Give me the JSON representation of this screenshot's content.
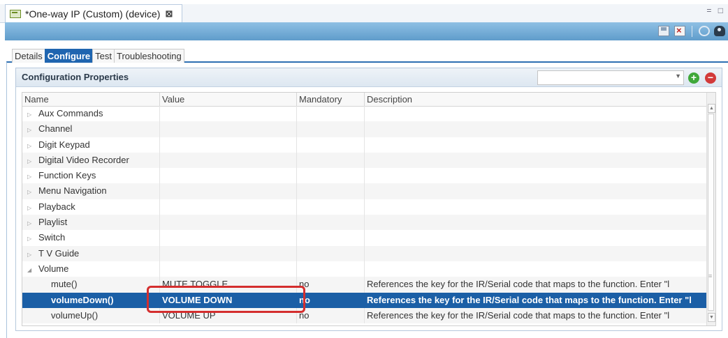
{
  "editor_tab": {
    "title": "*One-way IP (Custom) (device)",
    "close_icon": "close-icon"
  },
  "toolbar": {
    "icons": [
      "save-icon",
      "delete-icon",
      "refresh-icon",
      "preview-icon"
    ]
  },
  "window_controls": "= □",
  "subtabs": [
    "Details",
    "Configure",
    "Test",
    "Troubleshooting"
  ],
  "active_subtab": "Configure",
  "panel": {
    "title": "Configuration Properties",
    "combo_value": "",
    "add_label": "+",
    "remove_label": "−"
  },
  "table": {
    "columns": [
      "Name",
      "Value",
      "Mandatory",
      "Description"
    ],
    "rows": [
      {
        "name": "Aux Commands",
        "value": "",
        "mandatory": "",
        "description": "",
        "expander": "▷"
      },
      {
        "name": "Channel",
        "value": "",
        "mandatory": "",
        "description": "",
        "expander": "▷"
      },
      {
        "name": "Digit Keypad",
        "value": "",
        "mandatory": "",
        "description": "",
        "expander": "▷"
      },
      {
        "name": "Digital Video Recorder",
        "value": "",
        "mandatory": "",
        "description": "",
        "expander": "▷"
      },
      {
        "name": "Function Keys",
        "value": "",
        "mandatory": "",
        "description": "",
        "expander": "▷"
      },
      {
        "name": "Menu Navigation",
        "value": "",
        "mandatory": "",
        "description": "",
        "expander": "▷"
      },
      {
        "name": "Playback",
        "value": "",
        "mandatory": "",
        "description": "",
        "expander": "▷"
      },
      {
        "name": "Playlist",
        "value": "",
        "mandatory": "",
        "description": "",
        "expander": "▷"
      },
      {
        "name": "Switch",
        "value": "",
        "mandatory": "",
        "description": "",
        "expander": "▷"
      },
      {
        "name": "T V Guide",
        "value": "",
        "mandatory": "",
        "description": "",
        "expander": "▷"
      },
      {
        "name": "Volume",
        "value": "",
        "mandatory": "",
        "description": "",
        "expander": "◢"
      },
      {
        "name": "mute()",
        "value": "MUTE TOGGLE",
        "mandatory": "no",
        "description": "References the key for the IR/Serial code that maps to the function. Enter \"l",
        "expander": ""
      },
      {
        "name": "volumeDown()",
        "value": "VOLUME DOWN",
        "mandatory": "no",
        "description": "References the key for the IR/Serial code that maps to the function. Enter \"l",
        "expander": ""
      },
      {
        "name": "volumeUp()",
        "value": "VOLUME UP",
        "mandatory": "no",
        "description": "References the key for the IR/Serial code that maps to the function. Enter \"l",
        "expander": ""
      }
    ],
    "selected_row": "volumeDown()"
  },
  "colors": {
    "accent": "#1f65b0",
    "selected_row": "#1b5fa6",
    "toolbar": "#5f9ccb",
    "highlight_box": "#d42e2e"
  }
}
